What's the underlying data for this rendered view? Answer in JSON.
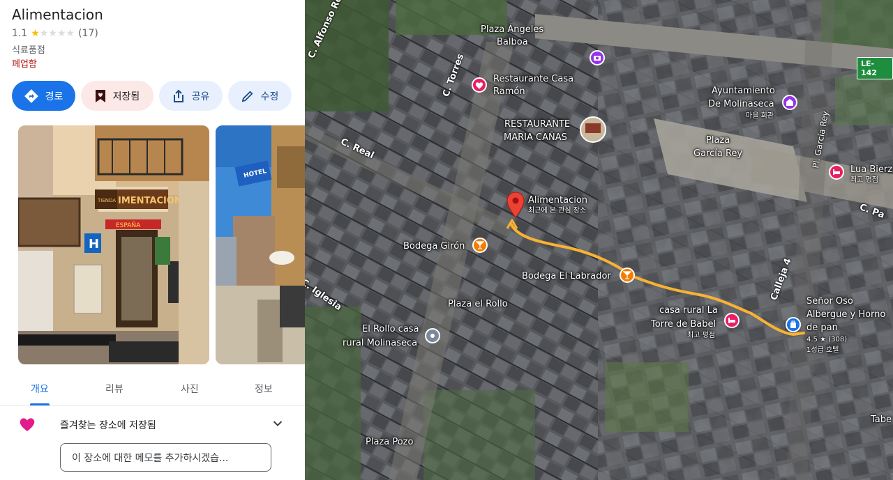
{
  "place": {
    "name": "Alimentacion",
    "rating": "1.1",
    "stars_filled": 1,
    "stars_total": 5,
    "review_count": "(17)",
    "category": "식료품점",
    "status": "폐업함"
  },
  "actions": {
    "directions": "경로",
    "saved": "저장됨",
    "share": "공유",
    "edit": "수정"
  },
  "photos": {
    "photo1_sign": "IMENTACION",
    "photo1_sign_left": "TIENDA",
    "photo1_banner": "ESPAÑA",
    "photo2_sign": "HOTEL"
  },
  "tabs": [
    "개요",
    "리뷰",
    "사진",
    "정보"
  ],
  "favorites": {
    "label": "즐겨찾는 장소에 저장됨",
    "memo_placeholder": "이 장소에 대한 메모를 추가하시겠습..."
  },
  "map": {
    "pin": {
      "name": "Alimentacion",
      "sub": "최근에 본 관심 장소"
    },
    "places": {
      "plaza_angeles_1": "Plaza Ángeles",
      "plaza_angeles_2": "Balboa",
      "casa_ramon_1": "Restaurante Casa",
      "casa_ramon_2": "Ramón",
      "maria_1": "RESTAURANTE",
      "maria_2": "MARIA CAÑAS",
      "ayunt_1": "Ayuntamiento",
      "ayunt_2": "De Molinaseca",
      "ayunt_3": "마을 회관",
      "plaza_garcia_1": "Plaza",
      "plaza_garcia_2": "García Rey",
      "lua_1": "Lua Bierz",
      "lua_2": "최고 평점",
      "giron": "Bodega Girón",
      "labrador": "Bodega El Labrador",
      "plaza_rollo": "Plaza el Rollo",
      "rollo_1": "El Rollo casa",
      "rollo_2": "rural Molinaseca",
      "babel_1": "casa rural La",
      "babel_2": "Torre de Babel",
      "babel_3": "최고 평점",
      "oso_1": "Señor Oso",
      "oso_2": "Albergue y Horno",
      "oso_3": "de pan",
      "oso_4": "4.5 ★ (308)",
      "oso_5": "1성급 호텔",
      "plaza_pozo": "Plaza Pozo",
      "tabe": "Tabe"
    },
    "streets": {
      "alfonso": "C. Alfonso Rojo",
      "torres": "C. Torres",
      "real": "C. Real",
      "iglesia": "C. Iglesia",
      "calleja": "Calleja 4",
      "garcia_rey": "Pl. García Rey",
      "pa": "C. Pa"
    },
    "road_badge": "LE-142",
    "colors": {
      "route": "#f9b233",
      "pin": "#ea4335",
      "road_badge": "#1e8e3e"
    }
  }
}
